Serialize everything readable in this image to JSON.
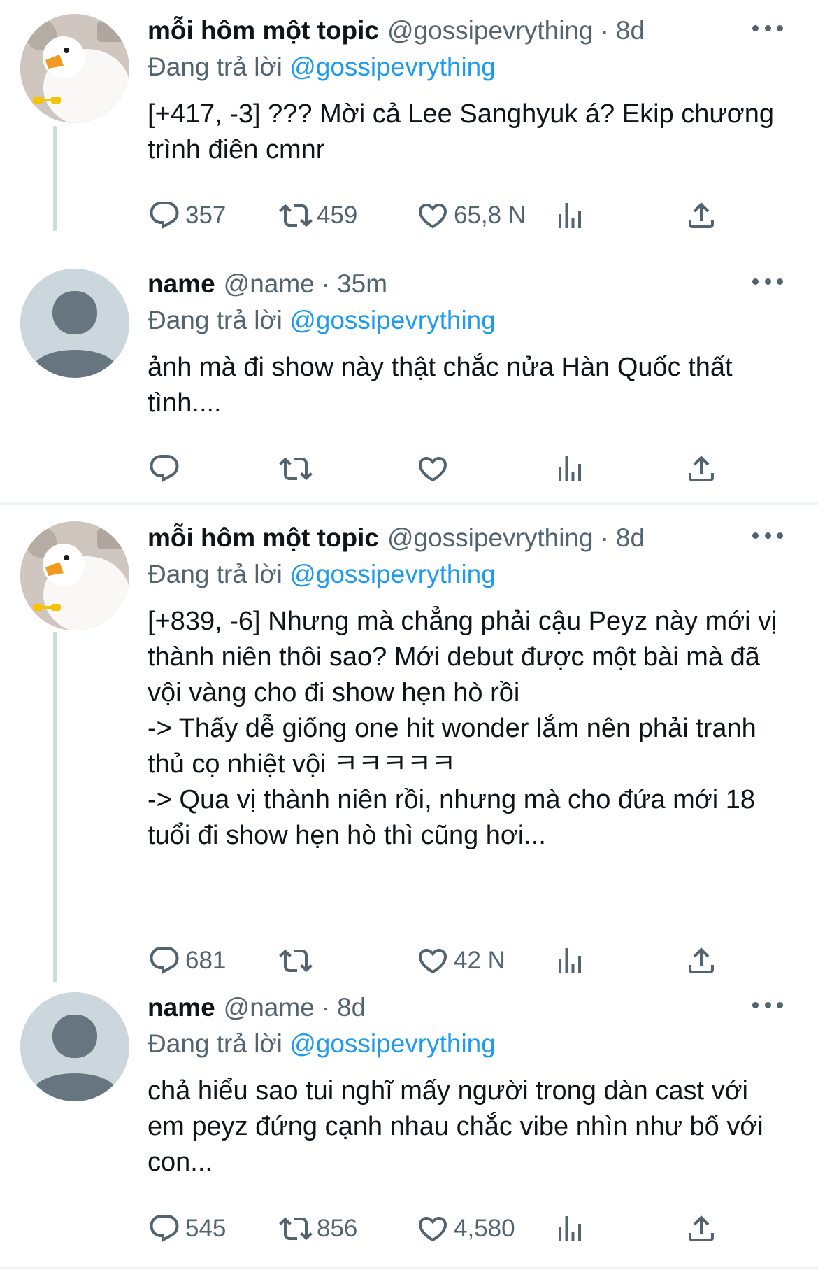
{
  "tweets": [
    {
      "display_name": "mỗi hôm một topic",
      "handle": "@gossipevrything",
      "time": "8d",
      "reply_prefix": "Đang trả lời",
      "reply_mention": "@gossipevrything",
      "text": "[+417, -3] ??? Mời cả Lee Sanghyuk á? Ekip chương trình điên cmnr",
      "replies": "357",
      "retweets": "459",
      "likes": "65,8 N",
      "avatar": "duck-photo"
    },
    {
      "display_name": "name",
      "handle": "@name",
      "time": "35m",
      "reply_prefix": "Đang trả lời",
      "reply_mention": "@gossipevrything",
      "text": "ảnh mà đi show này thật chắc nửa Hàn Quốc thất tình....",
      "replies": "",
      "retweets": "",
      "likes": "",
      "avatar": "default-avatar"
    },
    {
      "display_name": "mỗi hôm một topic",
      "handle": "@gossipevrything",
      "time": "8d",
      "reply_prefix": "Đang trả lời",
      "reply_mention": "@gossipevrything",
      "text": "[+839, -6] Nhưng mà chẳng phải cậu Peyz này mới vị thành niên thôi sao? Mới debut được một bài mà đã vội vàng cho đi show hẹn hò rồi\n-> Thấy dễ giống one hit wonder lắm nên phải tranh thủ cọ nhiệt vội ㅋㅋㅋㅋㅋ\n-> Qua vị thành niên rồi, nhưng mà cho đứa mới 18 tuổi đi show hẹn hò thì cũng hơi...",
      "replies": "681",
      "retweets": "",
      "likes": "42 N",
      "avatar": "duck-photo"
    },
    {
      "display_name": "name",
      "handle": "@name",
      "time": "8d",
      "reply_prefix": "Đang trả lời",
      "reply_mention": "@gossipevrything",
      "text": "chả hiểu sao tui nghĩ mấy người trong dàn cast với em peyz đứng cạnh nhau chắc vibe nhìn như bố với con...",
      "replies": "545",
      "retweets": "856",
      "likes": "4,580",
      "avatar": "default-avatar"
    }
  ],
  "colors": {
    "link": "#1d9bf0",
    "secondary": "#536471",
    "thread_line": "#cfd9de",
    "default_avatar_bg": "#ccd6dd"
  }
}
